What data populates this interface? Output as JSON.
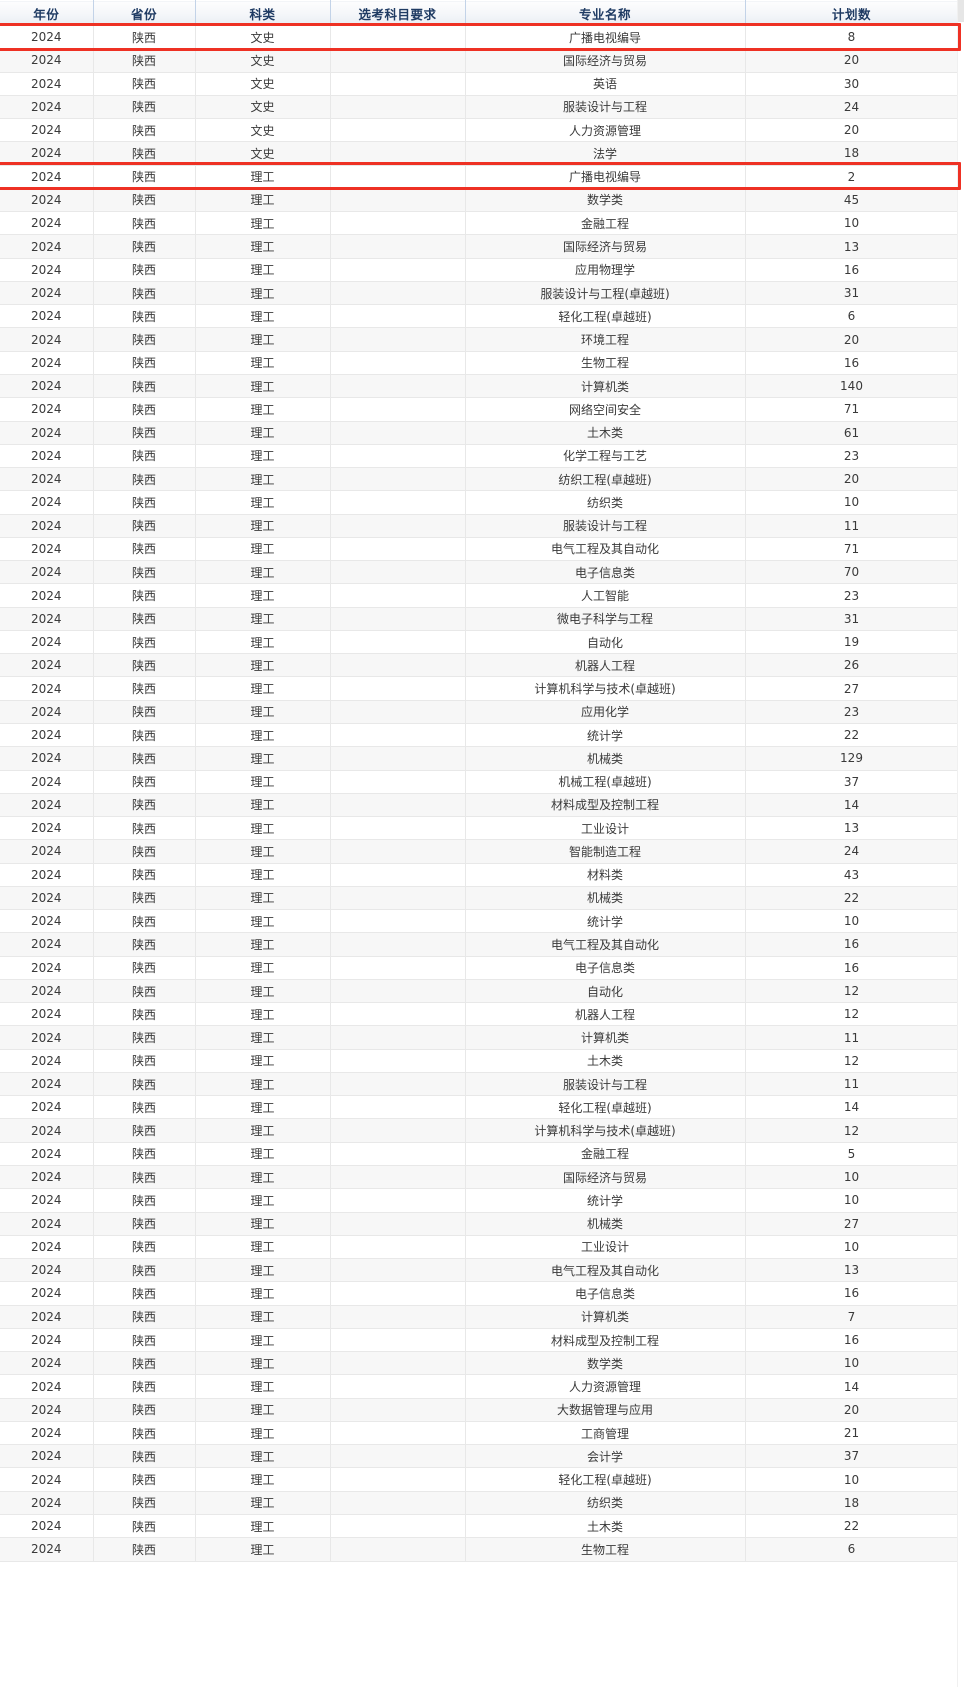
{
  "table": {
    "columns": [
      {
        "key": "year",
        "label": "年份"
      },
      {
        "key": "prov",
        "label": "省份"
      },
      {
        "key": "cat",
        "label": "科类"
      },
      {
        "key": "req",
        "label": "选考科目要求"
      },
      {
        "key": "major",
        "label": "专业名称"
      },
      {
        "key": "count",
        "label": "计划数"
      }
    ],
    "highlight_color": "#ee3124",
    "rows": [
      {
        "year": "2024",
        "prov": "陕西",
        "cat": "文史",
        "req": "",
        "major": "广播电视编导",
        "count": "8",
        "highlighted": true
      },
      {
        "year": "2024",
        "prov": "陕西",
        "cat": "文史",
        "req": "",
        "major": "国际经济与贸易",
        "count": "20",
        "highlighted": false
      },
      {
        "year": "2024",
        "prov": "陕西",
        "cat": "文史",
        "req": "",
        "major": "英语",
        "count": "30",
        "highlighted": false
      },
      {
        "year": "2024",
        "prov": "陕西",
        "cat": "文史",
        "req": "",
        "major": "服装设计与工程",
        "count": "24",
        "highlighted": false
      },
      {
        "year": "2024",
        "prov": "陕西",
        "cat": "文史",
        "req": "",
        "major": "人力资源管理",
        "count": "20",
        "highlighted": false
      },
      {
        "year": "2024",
        "prov": "陕西",
        "cat": "文史",
        "req": "",
        "major": "法学",
        "count": "18",
        "highlighted": false
      },
      {
        "year": "2024",
        "prov": "陕西",
        "cat": "理工",
        "req": "",
        "major": "广播电视编导",
        "count": "2",
        "highlighted": true
      },
      {
        "year": "2024",
        "prov": "陕西",
        "cat": "理工",
        "req": "",
        "major": "数学类",
        "count": "45",
        "highlighted": false
      },
      {
        "year": "2024",
        "prov": "陕西",
        "cat": "理工",
        "req": "",
        "major": "金融工程",
        "count": "10",
        "highlighted": false
      },
      {
        "year": "2024",
        "prov": "陕西",
        "cat": "理工",
        "req": "",
        "major": "国际经济与贸易",
        "count": "13",
        "highlighted": false
      },
      {
        "year": "2024",
        "prov": "陕西",
        "cat": "理工",
        "req": "",
        "major": "应用物理学",
        "count": "16",
        "highlighted": false
      },
      {
        "year": "2024",
        "prov": "陕西",
        "cat": "理工",
        "req": "",
        "major": "服装设计与工程(卓越班)",
        "count": "31",
        "highlighted": false
      },
      {
        "year": "2024",
        "prov": "陕西",
        "cat": "理工",
        "req": "",
        "major": "轻化工程(卓越班)",
        "count": "6",
        "highlighted": false
      },
      {
        "year": "2024",
        "prov": "陕西",
        "cat": "理工",
        "req": "",
        "major": "环境工程",
        "count": "20",
        "highlighted": false
      },
      {
        "year": "2024",
        "prov": "陕西",
        "cat": "理工",
        "req": "",
        "major": "生物工程",
        "count": "16",
        "highlighted": false
      },
      {
        "year": "2024",
        "prov": "陕西",
        "cat": "理工",
        "req": "",
        "major": "计算机类",
        "count": "140",
        "highlighted": false
      },
      {
        "year": "2024",
        "prov": "陕西",
        "cat": "理工",
        "req": "",
        "major": "网络空间安全",
        "count": "71",
        "highlighted": false
      },
      {
        "year": "2024",
        "prov": "陕西",
        "cat": "理工",
        "req": "",
        "major": "土木类",
        "count": "61",
        "highlighted": false
      },
      {
        "year": "2024",
        "prov": "陕西",
        "cat": "理工",
        "req": "",
        "major": "化学工程与工艺",
        "count": "23",
        "highlighted": false
      },
      {
        "year": "2024",
        "prov": "陕西",
        "cat": "理工",
        "req": "",
        "major": "纺织工程(卓越班)",
        "count": "20",
        "highlighted": false
      },
      {
        "year": "2024",
        "prov": "陕西",
        "cat": "理工",
        "req": "",
        "major": "纺织类",
        "count": "10",
        "highlighted": false
      },
      {
        "year": "2024",
        "prov": "陕西",
        "cat": "理工",
        "req": "",
        "major": "服装设计与工程",
        "count": "11",
        "highlighted": false
      },
      {
        "year": "2024",
        "prov": "陕西",
        "cat": "理工",
        "req": "",
        "major": "电气工程及其自动化",
        "count": "71",
        "highlighted": false
      },
      {
        "year": "2024",
        "prov": "陕西",
        "cat": "理工",
        "req": "",
        "major": "电子信息类",
        "count": "70",
        "highlighted": false
      },
      {
        "year": "2024",
        "prov": "陕西",
        "cat": "理工",
        "req": "",
        "major": "人工智能",
        "count": "23",
        "highlighted": false
      },
      {
        "year": "2024",
        "prov": "陕西",
        "cat": "理工",
        "req": "",
        "major": "微电子科学与工程",
        "count": "31",
        "highlighted": false
      },
      {
        "year": "2024",
        "prov": "陕西",
        "cat": "理工",
        "req": "",
        "major": "自动化",
        "count": "19",
        "highlighted": false
      },
      {
        "year": "2024",
        "prov": "陕西",
        "cat": "理工",
        "req": "",
        "major": "机器人工程",
        "count": "26",
        "highlighted": false
      },
      {
        "year": "2024",
        "prov": "陕西",
        "cat": "理工",
        "req": "",
        "major": "计算机科学与技术(卓越班)",
        "count": "27",
        "highlighted": false
      },
      {
        "year": "2024",
        "prov": "陕西",
        "cat": "理工",
        "req": "",
        "major": "应用化学",
        "count": "23",
        "highlighted": false
      },
      {
        "year": "2024",
        "prov": "陕西",
        "cat": "理工",
        "req": "",
        "major": "统计学",
        "count": "22",
        "highlighted": false
      },
      {
        "year": "2024",
        "prov": "陕西",
        "cat": "理工",
        "req": "",
        "major": "机械类",
        "count": "129",
        "highlighted": false
      },
      {
        "year": "2024",
        "prov": "陕西",
        "cat": "理工",
        "req": "",
        "major": "机械工程(卓越班)",
        "count": "37",
        "highlighted": false
      },
      {
        "year": "2024",
        "prov": "陕西",
        "cat": "理工",
        "req": "",
        "major": "材料成型及控制工程",
        "count": "14",
        "highlighted": false
      },
      {
        "year": "2024",
        "prov": "陕西",
        "cat": "理工",
        "req": "",
        "major": "工业设计",
        "count": "13",
        "highlighted": false
      },
      {
        "year": "2024",
        "prov": "陕西",
        "cat": "理工",
        "req": "",
        "major": "智能制造工程",
        "count": "24",
        "highlighted": false
      },
      {
        "year": "2024",
        "prov": "陕西",
        "cat": "理工",
        "req": "",
        "major": "材料类",
        "count": "43",
        "highlighted": false
      },
      {
        "year": "2024",
        "prov": "陕西",
        "cat": "理工",
        "req": "",
        "major": "机械类",
        "count": "22",
        "highlighted": false
      },
      {
        "year": "2024",
        "prov": "陕西",
        "cat": "理工",
        "req": "",
        "major": "统计学",
        "count": "10",
        "highlighted": false
      },
      {
        "year": "2024",
        "prov": "陕西",
        "cat": "理工",
        "req": "",
        "major": "电气工程及其自动化",
        "count": "16",
        "highlighted": false
      },
      {
        "year": "2024",
        "prov": "陕西",
        "cat": "理工",
        "req": "",
        "major": "电子信息类",
        "count": "16",
        "highlighted": false
      },
      {
        "year": "2024",
        "prov": "陕西",
        "cat": "理工",
        "req": "",
        "major": "自动化",
        "count": "12",
        "highlighted": false
      },
      {
        "year": "2024",
        "prov": "陕西",
        "cat": "理工",
        "req": "",
        "major": "机器人工程",
        "count": "12",
        "highlighted": false
      },
      {
        "year": "2024",
        "prov": "陕西",
        "cat": "理工",
        "req": "",
        "major": "计算机类",
        "count": "11",
        "highlighted": false
      },
      {
        "year": "2024",
        "prov": "陕西",
        "cat": "理工",
        "req": "",
        "major": "土木类",
        "count": "12",
        "highlighted": false
      },
      {
        "year": "2024",
        "prov": "陕西",
        "cat": "理工",
        "req": "",
        "major": "服装设计与工程",
        "count": "11",
        "highlighted": false
      },
      {
        "year": "2024",
        "prov": "陕西",
        "cat": "理工",
        "req": "",
        "major": "轻化工程(卓越班)",
        "count": "14",
        "highlighted": false
      },
      {
        "year": "2024",
        "prov": "陕西",
        "cat": "理工",
        "req": "",
        "major": "计算机科学与技术(卓越班)",
        "count": "12",
        "highlighted": false
      },
      {
        "year": "2024",
        "prov": "陕西",
        "cat": "理工",
        "req": "",
        "major": "金融工程",
        "count": "5",
        "highlighted": false
      },
      {
        "year": "2024",
        "prov": "陕西",
        "cat": "理工",
        "req": "",
        "major": "国际经济与贸易",
        "count": "10",
        "highlighted": false
      },
      {
        "year": "2024",
        "prov": "陕西",
        "cat": "理工",
        "req": "",
        "major": "统计学",
        "count": "10",
        "highlighted": false
      },
      {
        "year": "2024",
        "prov": "陕西",
        "cat": "理工",
        "req": "",
        "major": "机械类",
        "count": "27",
        "highlighted": false
      },
      {
        "year": "2024",
        "prov": "陕西",
        "cat": "理工",
        "req": "",
        "major": "工业设计",
        "count": "10",
        "highlighted": false
      },
      {
        "year": "2024",
        "prov": "陕西",
        "cat": "理工",
        "req": "",
        "major": "电气工程及其自动化",
        "count": "13",
        "highlighted": false
      },
      {
        "year": "2024",
        "prov": "陕西",
        "cat": "理工",
        "req": "",
        "major": "电子信息类",
        "count": "16",
        "highlighted": false
      },
      {
        "year": "2024",
        "prov": "陕西",
        "cat": "理工",
        "req": "",
        "major": "计算机类",
        "count": "7",
        "highlighted": false
      },
      {
        "year": "2024",
        "prov": "陕西",
        "cat": "理工",
        "req": "",
        "major": "材料成型及控制工程",
        "count": "16",
        "highlighted": false
      },
      {
        "year": "2024",
        "prov": "陕西",
        "cat": "理工",
        "req": "",
        "major": "数学类",
        "count": "10",
        "highlighted": false
      },
      {
        "year": "2024",
        "prov": "陕西",
        "cat": "理工",
        "req": "",
        "major": "人力资源管理",
        "count": "14",
        "highlighted": false
      },
      {
        "year": "2024",
        "prov": "陕西",
        "cat": "理工",
        "req": "",
        "major": "大数据管理与应用",
        "count": "20",
        "highlighted": false
      },
      {
        "year": "2024",
        "prov": "陕西",
        "cat": "理工",
        "req": "",
        "major": "工商管理",
        "count": "21",
        "highlighted": false
      },
      {
        "year": "2024",
        "prov": "陕西",
        "cat": "理工",
        "req": "",
        "major": "会计学",
        "count": "37",
        "highlighted": false
      },
      {
        "year": "2024",
        "prov": "陕西",
        "cat": "理工",
        "req": "",
        "major": "轻化工程(卓越班)",
        "count": "10",
        "highlighted": false
      },
      {
        "year": "2024",
        "prov": "陕西",
        "cat": "理工",
        "req": "",
        "major": "纺织类",
        "count": "18",
        "highlighted": false
      },
      {
        "year": "2024",
        "prov": "陕西",
        "cat": "理工",
        "req": "",
        "major": "土木类",
        "count": "22",
        "highlighted": false
      },
      {
        "year": "2024",
        "prov": "陕西",
        "cat": "理工",
        "req": "",
        "major": "生物工程",
        "count": "6",
        "highlighted": false
      }
    ]
  }
}
